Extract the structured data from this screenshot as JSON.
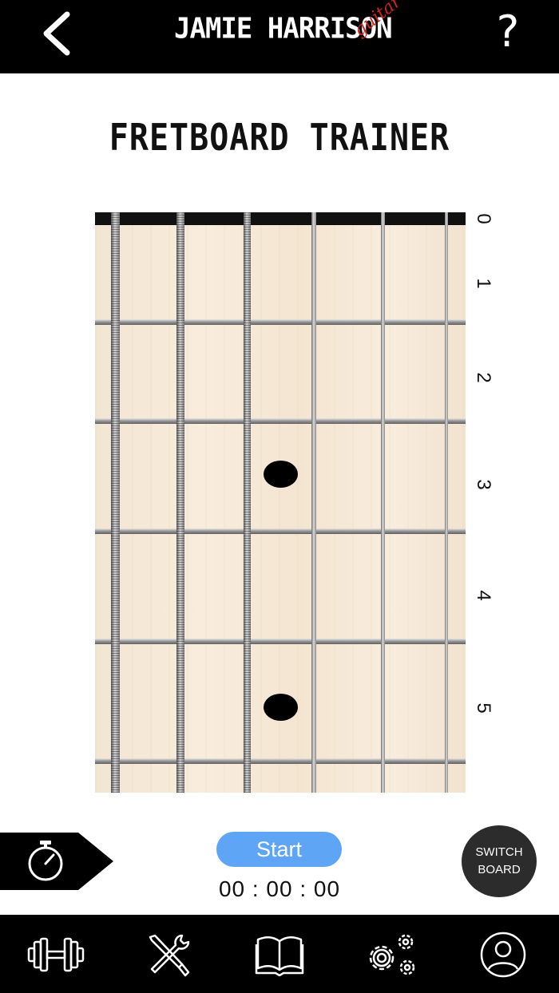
{
  "header": {
    "logo_main": "JAMIE HARRISON",
    "logo_sub": "guitar",
    "help_label": "?"
  },
  "page": {
    "title": "FRETBOARD TRAINER"
  },
  "fretboard": {
    "fret_numbers": [
      "0",
      "1",
      "2",
      "3",
      "4",
      "5"
    ],
    "inlay_frets": [
      3,
      5
    ]
  },
  "controls": {
    "start_label": "Start",
    "timer": "00 : 00 : 00",
    "switch_line1": "SWITCH",
    "switch_line2": "BOARD"
  },
  "nav": {
    "items": [
      "dumbbell-icon",
      "tools-icon",
      "book-icon",
      "gears-icon",
      "user-icon"
    ]
  },
  "colors": {
    "header_bg": "#000000",
    "start_button": "#5ea6f5",
    "logo_accent": "#d0231f",
    "switch_button": "#2c2c2c"
  }
}
